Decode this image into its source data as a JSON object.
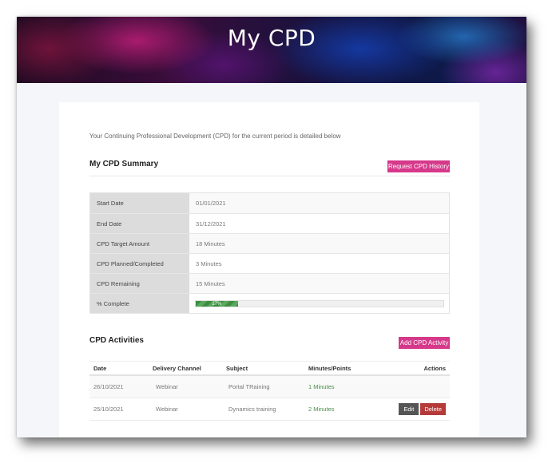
{
  "page": {
    "title": "My CPD"
  },
  "intro": "Your Continuing Professional Development (CPD) for the current period is detailed below",
  "summary": {
    "heading": "My CPD Summary",
    "request_history_label": "Request CPD History",
    "rows": [
      {
        "label": "Start Date",
        "value": "01/01/2021"
      },
      {
        "label": "End Date",
        "value": "31/12/2021"
      },
      {
        "label": "CPD Target Amount",
        "value": "18 Minutes"
      },
      {
        "label": "CPD Planned/Completed",
        "value": "3 Minutes"
      },
      {
        "label": "CPD Remaining",
        "value": "15 Minutes"
      },
      {
        "label": "% Complete",
        "value": "17%"
      }
    ],
    "progress_percent": 17,
    "progress_color": "#3e8e41"
  },
  "activities": {
    "heading": "CPD Activities",
    "add_label": "Add CPD Activity",
    "columns": [
      "Date",
      "Delivery Channel",
      "Subject",
      "Minutes/Points",
      "Actions"
    ],
    "rows": [
      {
        "date": "26/10/2021",
        "channel": "Webinar",
        "subject": "Portal TRaining",
        "minutes": "1 Minutes",
        "actions": []
      },
      {
        "date": "25/10/2021",
        "channel": "Webinar",
        "subject": "Dynamics training",
        "minutes": "2 Minutes",
        "actions": [
          "Edit",
          "Delete"
        ]
      }
    ]
  },
  "colors": {
    "accent": "#d6388a",
    "delete": "#b53a3a",
    "edit": "#555555"
  }
}
